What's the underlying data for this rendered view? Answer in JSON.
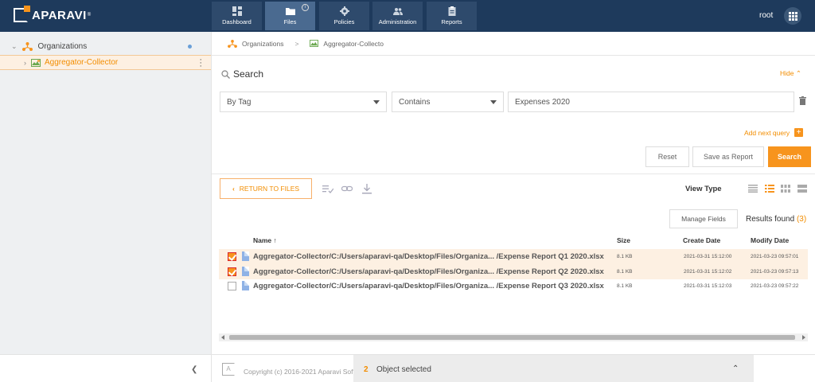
{
  "app": {
    "logo_text": "APARAVI",
    "logo_mark": "®",
    "user": "root"
  },
  "nav": [
    {
      "label": "Dashboard",
      "icon": "dashboard-icon"
    },
    {
      "label": "Files",
      "icon": "folder-icon",
      "active": true
    },
    {
      "label": "Policies",
      "icon": "gear-icon"
    },
    {
      "label": "Administration",
      "icon": "users-icon"
    },
    {
      "label": "Reports",
      "icon": "clipboard-icon"
    }
  ],
  "tree": {
    "root_label": "Organizations",
    "selected_label": "Aggregator-Collector"
  },
  "breadcrumb": {
    "items": [
      "Organizations",
      "Aggregator-Collecto"
    ],
    "separator": ">"
  },
  "search": {
    "title": "Search",
    "hide_label": "Hide",
    "field_type": "By Tag",
    "operator": "Contains",
    "value": "Expenses 2020",
    "add_query_label": "Add next query",
    "reset_label": "Reset",
    "save_report_label": "Save as Report",
    "search_label": "Search"
  },
  "results": {
    "return_label": "RETURN TO FILES",
    "view_type_label": "View Type",
    "manage_fields_label": "Manage Fields",
    "results_found_label": "Results found",
    "count": "(3)",
    "columns": {
      "name": "Name",
      "sort_icon": "↑",
      "size": "Size",
      "create": "Create Date",
      "modify": "Modify Date"
    },
    "rows": [
      {
        "name": "Aggregator-Collector/C:/Users/aparavi-qa/Desktop/Files/Organiza... /Expense Report Q1 2020.xlsx",
        "size": "8.1 KB",
        "create": "2021-03-31 15:12:00",
        "modify": "2021-03-23 09:57:01",
        "selected": true
      },
      {
        "name": "Aggregator-Collector/C:/Users/aparavi-qa/Desktop/Files/Organiza... /Expense Report Q2 2020.xlsx",
        "size": "8.1 KB",
        "create": "2021-03-31 15:12:02",
        "modify": "2021-03-23 09:57:13",
        "selected": true
      },
      {
        "name": "Aggregator-Collector/C:/Users/aparavi-qa/Desktop/Files/Organiza... /Expense Report Q3 2020.xlsx",
        "size": "8.1 KB",
        "create": "2021-03-31 15:12:03",
        "modify": "2021-03-23 09:57:22",
        "selected": false
      }
    ]
  },
  "footer": {
    "copyright": "Copyright (c) 2016-2021 Aparavi Software",
    "selected_count": "2",
    "selected_label": "Object selected"
  },
  "colors": {
    "topbar": "#1e3a5c",
    "accent": "#f7941d",
    "selected_row": "#fdf0e2"
  }
}
